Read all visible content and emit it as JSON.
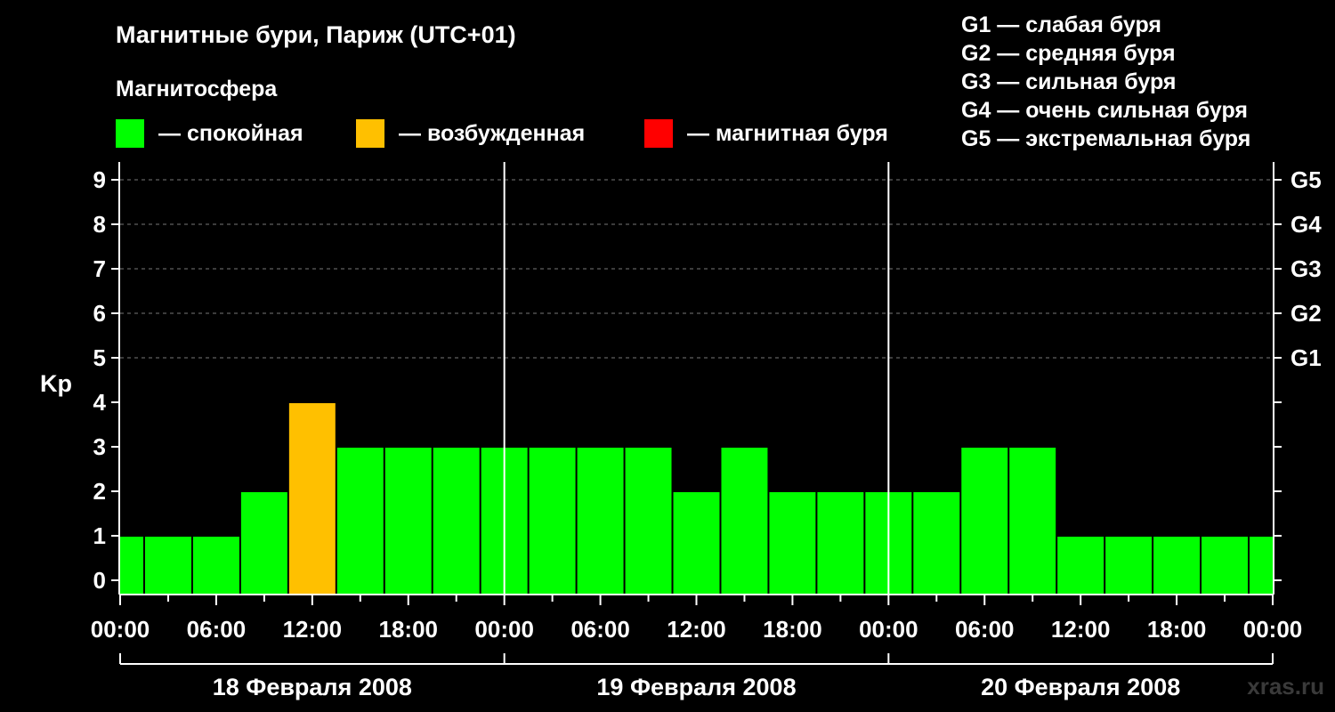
{
  "chart_data": {
    "type": "bar",
    "title": "Магнитные бури, Париж (UTC+01)",
    "subtitle": "Магнитосфера",
    "ylabel": "Kp",
    "ylim": [
      0,
      9
    ],
    "yticks": [
      "0",
      "1",
      "2",
      "3",
      "4",
      "5",
      "6",
      "7",
      "8",
      "9"
    ],
    "g_ticks": [
      {
        "value": 5,
        "label": "G1"
      },
      {
        "value": 6,
        "label": "G2"
      },
      {
        "value": 7,
        "label": "G3"
      },
      {
        "value": 8,
        "label": "G4"
      },
      {
        "value": 9,
        "label": "G5"
      }
    ],
    "x_tick_labels": [
      "00:00",
      "06:00",
      "12:00",
      "18:00",
      "00:00",
      "06:00",
      "12:00",
      "18:00",
      "00:00",
      "06:00",
      "12:00",
      "18:00",
      "00:00"
    ],
    "days": [
      "18 Февраля 2008",
      "19 Февраля 2008",
      "20 Февраля 2008"
    ],
    "x_hours": [
      0,
      3,
      6,
      9,
      12,
      15,
      18,
      21,
      24,
      27,
      30,
      33,
      36,
      39,
      42,
      45,
      48,
      51,
      54,
      57,
      60,
      63,
      66,
      69,
      72
    ],
    "values": [
      1,
      1,
      1,
      2,
      4,
      3,
      3,
      3,
      3,
      3,
      3,
      3,
      2,
      3,
      2,
      2,
      2,
      2,
      3,
      3,
      1,
      1,
      1,
      1,
      1
    ],
    "status_colors": {
      "quiet": "#00ff00",
      "excited": "#ffc000",
      "storm": "#ff0000"
    },
    "grid": true
  },
  "legend": {
    "items": [
      {
        "key": "quiet",
        "label": "— спокойная",
        "color": "#00ff00"
      },
      {
        "key": "excited",
        "label": "— возбужденная",
        "color": "#ffc000"
      },
      {
        "key": "storm",
        "label": "— магнитная буря",
        "color": "#ff0000"
      }
    ],
    "g_scale": [
      "G1 — слабая буря",
      "G2 — средняя буря",
      "G3 — сильная буря",
      "G4 — очень сильная буря",
      "G5 — экстремальная буря"
    ]
  },
  "watermark": "xras.ru"
}
